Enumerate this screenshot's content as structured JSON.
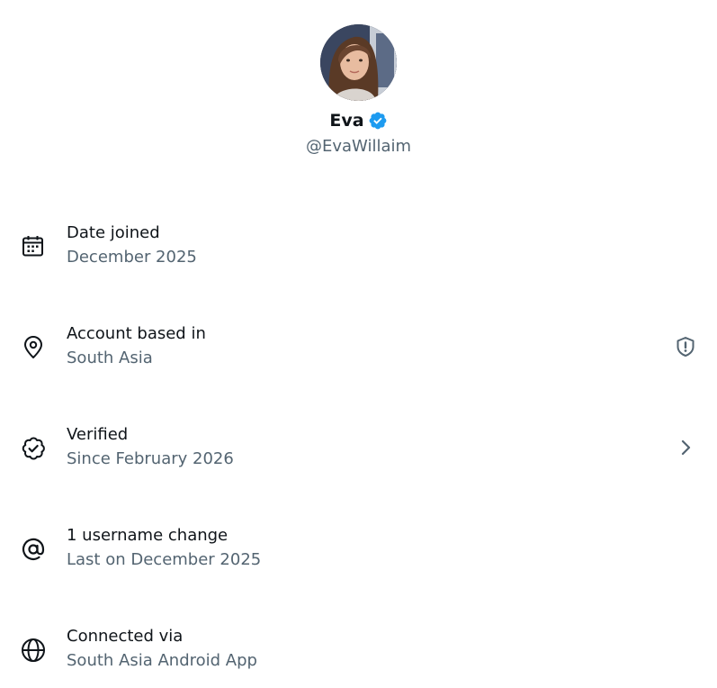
{
  "profile": {
    "display_name": "Eva",
    "handle": "@EvaWillaim",
    "verified_badge_icon": "verified-badge-icon",
    "badge_color": "#1d9bf0"
  },
  "rows": [
    {
      "icon": "calendar-icon",
      "title": "Date joined",
      "subtitle": "December 2025"
    },
    {
      "icon": "location-pin-icon",
      "title": "Account based in",
      "subtitle": "South Asia",
      "trailing_icon": "shield-alert-icon"
    },
    {
      "icon": "verified-outline-icon",
      "title": "Verified",
      "subtitle": "Since February 2026",
      "trailing_icon": "chevron-right-icon"
    },
    {
      "icon": "at-sign-icon",
      "title": "1 username change",
      "subtitle": "Last on December 2025"
    },
    {
      "icon": "globe-icon",
      "title": "Connected via",
      "subtitle": "South Asia Android App"
    }
  ],
  "colors": {
    "primary_text": "#0f1419",
    "secondary_text": "#536471",
    "icon_stroke": "#0f1419"
  }
}
